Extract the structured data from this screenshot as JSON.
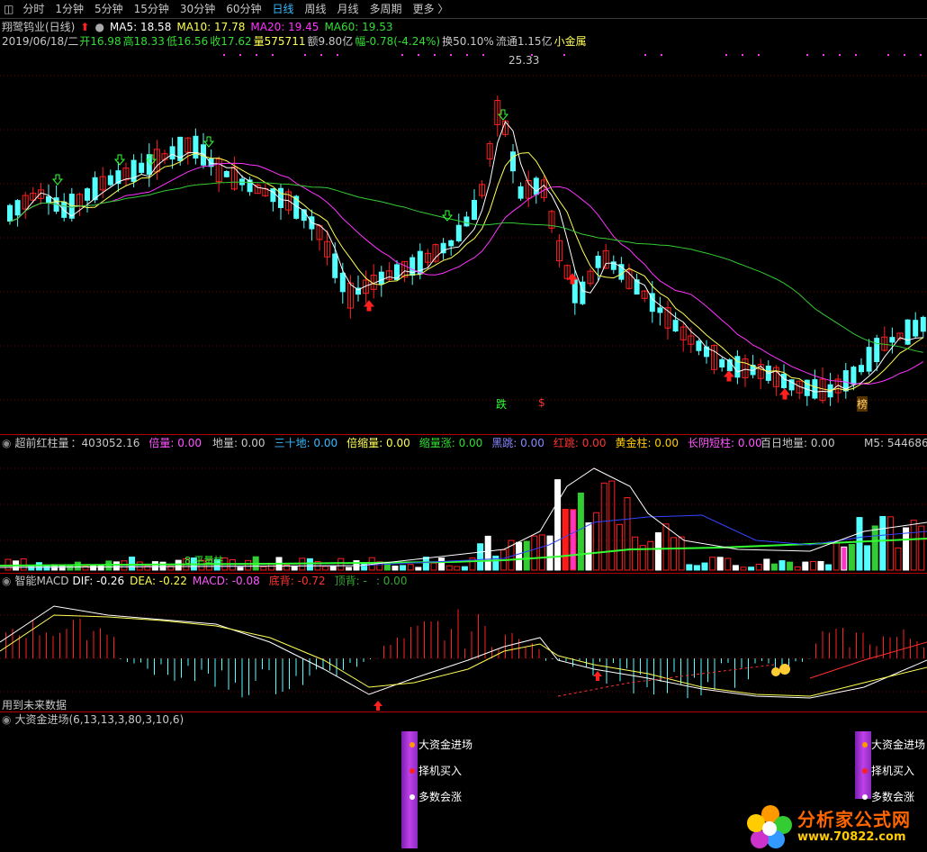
{
  "toolbar": {
    "items": [
      "分时",
      "1分钟",
      "5分钟",
      "15分钟",
      "30分钟",
      "60分钟",
      "日线",
      "周线",
      "月线",
      "多周期",
      "更多 〉"
    ],
    "active_index": 6
  },
  "main": {
    "stock": "翔鹭钨业(日线)",
    "ma5": "MA5: 18.58",
    "ma10": "MA10: 17.78",
    "ma20": "MA20: 19.45",
    "ma60": "MA60: 19.53",
    "info_date": "2019/06/18/二",
    "open": "开16.98",
    "high": "高18.33",
    "low": "低16.56",
    "close": "收17.62",
    "volume": "量575711",
    "amount": "额9.80亿",
    "change": "幅-0.78(-4.24%)",
    "turnover": "换50.10%",
    "float": "流通1.15亿",
    "sector": "小金属",
    "peak_label": "25.33",
    "mark_die": "跌",
    "mark_dollar": "$",
    "mark_bang": "榜"
  },
  "vol_panel": {
    "title": "超前红柱量",
    "value": "：403052.16",
    "beiliang": "倍量: 0.00",
    "diliang": "地量: 0.00",
    "sanshidi": "三十地: 0.00",
    "beisuoliang": "倍缩量: 0.00",
    "suoliangzhang": "缩量涨: 0.00",
    "heitiao": "黑跳: 0.00",
    "hongtiao": "红跳: 0.00",
    "huangjinzhu": "黄金柱: 0.00",
    "changyin": "长阴短柱: 0.00",
    "bairidiliang": "百日地量: 0.00",
    "m5": "M5: 544686.",
    "pingliang": "8 平量柱"
  },
  "macd_panel": {
    "title": "智能MACD",
    "dif": "DIF: -0.26",
    "dea": "DEA: -0.22",
    "macd": "MACD: -0.08",
    "dibei": "底背: -0.72",
    "dingbei": "顶背: -",
    "colon0": ": 0.00",
    "future_note": "用到未来数据"
  },
  "bigfund_panel": {
    "title": "大资金进场(6,13,13,3,80,3,10,6)",
    "label1": "大资金进场",
    "label2": "择机买入",
    "label3": "多数会涨"
  },
  "watermark": {
    "cn": "分析家公式网",
    "url": "www.70822.com"
  },
  "colors": {
    "up": "#ff2020",
    "down": "#54ffff",
    "ma5": "#ffffff",
    "ma10": "#ffff55",
    "ma20": "#ff33ff",
    "ma60": "#33cc33"
  }
}
